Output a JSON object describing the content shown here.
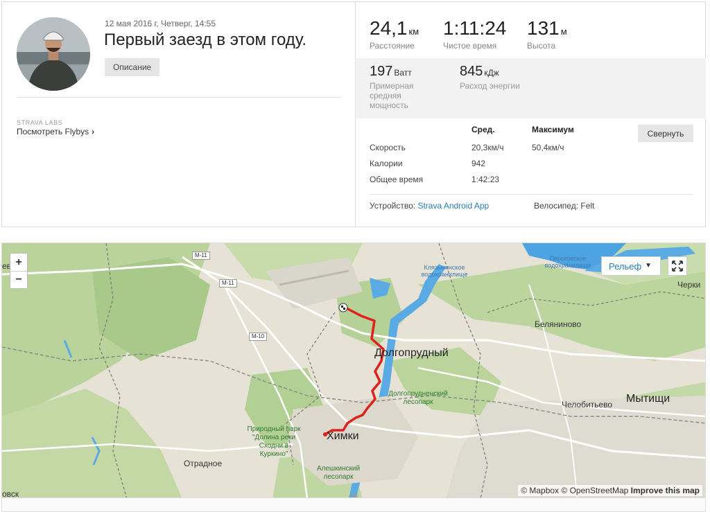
{
  "activity": {
    "date": "12 мая 2016 г, Четверг, 14:55",
    "title": "Первый заезд в этом году.",
    "description_button": "Описание",
    "avatar_icon": "rider-avatar"
  },
  "labs": {
    "heading": "STRAVA LABS",
    "flyby_link": "Посмотреть Flybys",
    "chevron": "›"
  },
  "stats": {
    "distance": {
      "value": "24,1",
      "unit": "км",
      "label": "Расстояние"
    },
    "moving_time": {
      "value": "1:11:24",
      "unit": "",
      "label": "Чистое время"
    },
    "elevation": {
      "value": "131",
      "unit": "м",
      "label": "Высота"
    },
    "power": {
      "value": "197",
      "unit": "Ватт",
      "label": "Примерная средняя мощность"
    },
    "energy": {
      "value": "845",
      "unit": "кДж",
      "label": "Расход энергии"
    }
  },
  "details": {
    "col_avg": "Сред.",
    "col_max": "Максимум",
    "collapse_button": "Свернуть",
    "rows": [
      {
        "label": "Скорость",
        "avg": "20,3км/ч",
        "max": "50,4км/ч"
      },
      {
        "label": "Калории",
        "avg": "942",
        "max": ""
      },
      {
        "label": "Общее время",
        "avg": "1:42:23",
        "max": ""
      }
    ],
    "device_label": "Устройство:",
    "device_value": "Strava Android App",
    "bike_label": "Велосипед:",
    "bike_value": "Felt"
  },
  "map": {
    "zoom_in": "+",
    "zoom_out": "−",
    "layer_button": "Рельеф",
    "layer_caret": "▼",
    "attribution_mapbox": "© Mapbox",
    "attribution_osm": "© OpenStreetMap",
    "improve_link": "Improve this map",
    "labels": {
      "dolgoprudny": "Долгопрудный",
      "mytishchi": "Мытищи",
      "khimki": "Химки",
      "belyaninovo": "Беляниново",
      "chelobitevo": "Челобитьево",
      "otradnoe": "Отрадное",
      "cherki": "Черки",
      "evka": "евка",
      "ovsk": "овск",
      "dolgoprudny_forest": "Долгопрудненский лесопарк",
      "aleshkinsky_forest": "Алешкинский лесопарк",
      "skhodnya_park": "Природный парк \"Долина реки Сходни в Куркино\"",
      "klyazma_res": "Клязьминское водохранилище",
      "pirogov_res": "Пироговское водохранилище",
      "m11_a": "M-11",
      "m11_b": "M-11",
      "m10": "M-10"
    },
    "route_color": "#e0201b"
  }
}
